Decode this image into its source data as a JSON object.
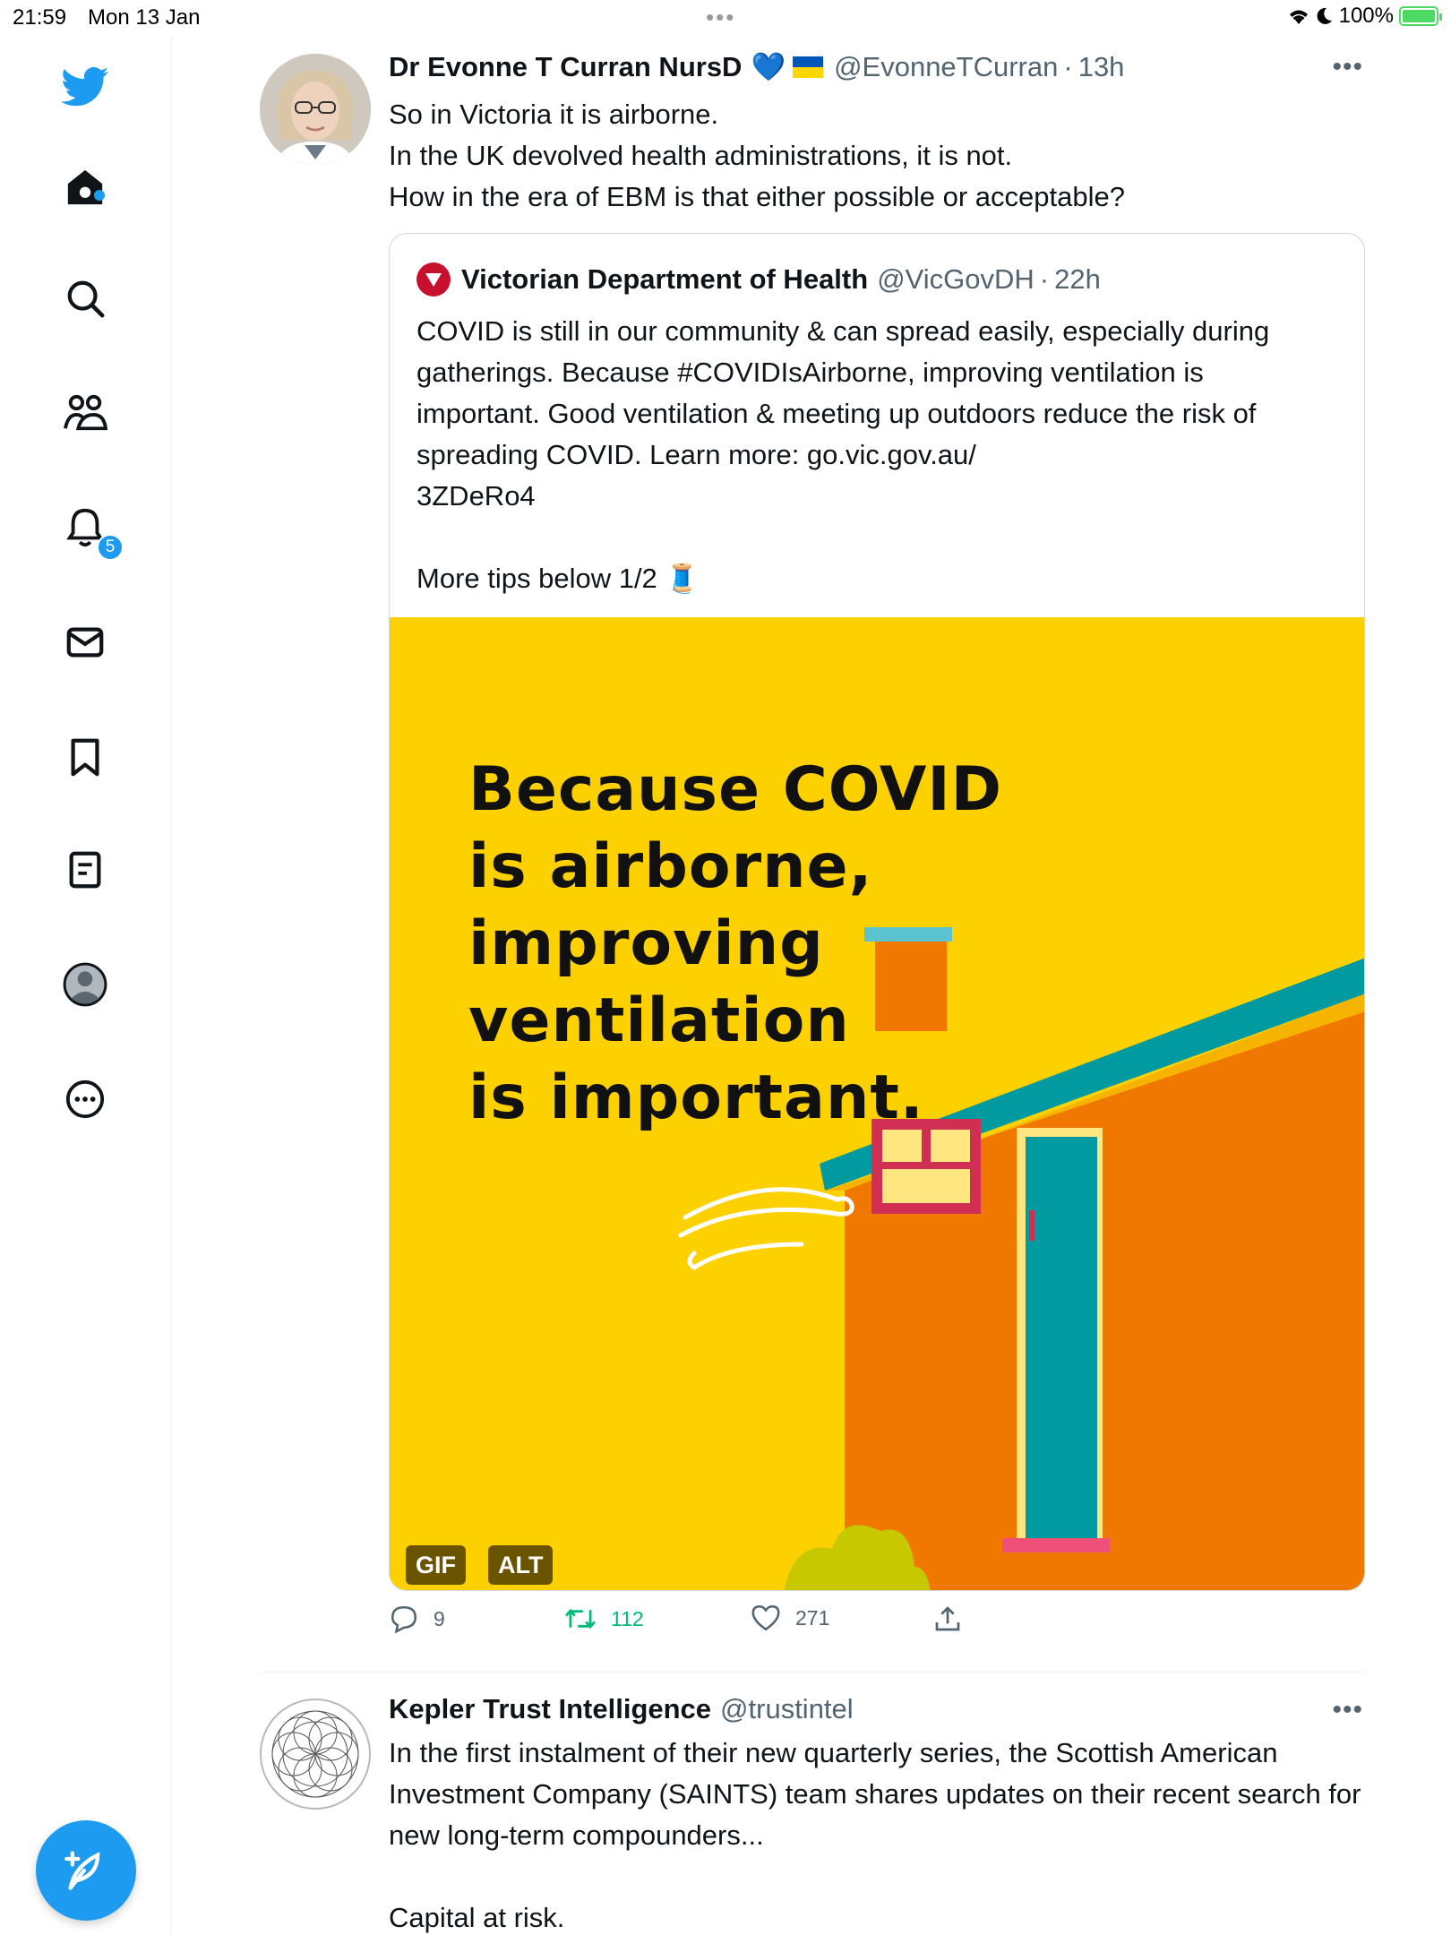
{
  "status_bar": {
    "time": "21:59",
    "date": "Mon 13 Jan",
    "battery": "100%"
  },
  "sidebar": {
    "items": [
      {
        "name": "twitter-logo-icon"
      },
      {
        "name": "home-icon"
      },
      {
        "name": "search-icon"
      },
      {
        "name": "communities-icon"
      },
      {
        "name": "notifications-icon"
      },
      {
        "name": "messages-icon"
      },
      {
        "name": "bookmarks-icon"
      },
      {
        "name": "lists-icon"
      },
      {
        "name": "profile-icon"
      },
      {
        "name": "more-icon"
      }
    ],
    "notification_count": "5",
    "compose_icon": "compose-icon"
  },
  "tweet": {
    "name": "Dr Evonne T Curran NursD",
    "emoji": "💙",
    "handle": "@EvonneTCurran",
    "time": "13h",
    "text": "So in Victoria it is airborne.\nIn the UK devolved health administrations, it is not.\nHow in the era of EBM is that either possible or acceptable?",
    "quote": {
      "name": "Victorian Department of Health",
      "handle": "@VicGovDH",
      "time": "22h",
      "text": "COVID is still in our community & can spread easily, especially during gatherings. Because #COVIDIsAirborne, improving ventilation is important. Good ventilation & meeting up outdoors reduce the risk of spreading COVID. Learn more: go.vic.gov.au/\n3ZDeRo4\n\nMore tips below 1/2 🧵",
      "media_headline": "Because COVID\nis airborne,\nimproving\nventilation\nis important.",
      "gif_label": "GIF",
      "alt_label": "ALT"
    },
    "actions": {
      "replies": "9",
      "retweets": "112",
      "likes": "271"
    },
    "colors": {
      "retweet": "#00ba7c",
      "accent": "#1d9bf0"
    }
  },
  "tweet2": {
    "name": "Kepler Trust Intelligence",
    "handle": "@trustintel",
    "text": "In the first instalment of their new quarterly series, the Scottish American Investment Company (SAINTS) team shares updates on their recent search for new long-term compounders...\n\nCapital at risk."
  },
  "separator": "·",
  "more_glyph": "•••"
}
